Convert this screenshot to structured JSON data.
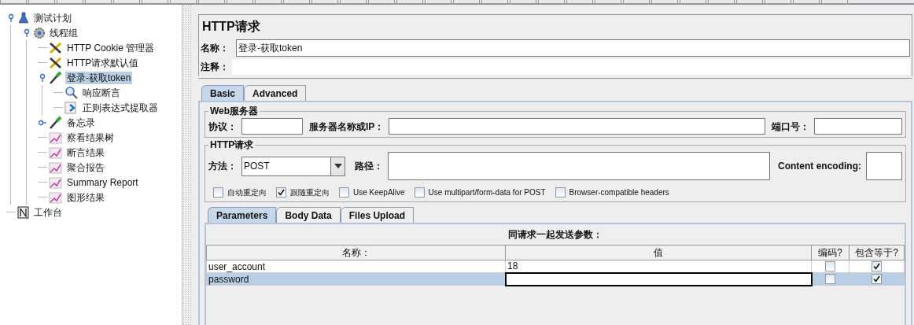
{
  "tree": [
    {
      "label": "测试计划",
      "kind": "plan",
      "expanded": true,
      "selected": false,
      "children": [
        {
          "label": "线程组",
          "kind": "threads",
          "expanded": true,
          "selected": false,
          "children": [
            {
              "label": "HTTP Cookie 管理器",
              "kind": "config",
              "selected": false
            },
            {
              "label": "HTTP请求默认值",
              "kind": "config",
              "selected": false
            },
            {
              "label": "登录-获取token",
              "kind": "sampler",
              "expanded": true,
              "selected": true,
              "children": [
                {
                  "label": "响应断言",
                  "kind": "assertion",
                  "selected": false
                },
                {
                  "label": "正则表达式提取器",
                  "kind": "extractor",
                  "selected": false
                }
              ]
            },
            {
              "label": "备忘录",
              "kind": "sampler",
              "expanded": false,
              "selected": false
            },
            {
              "label": "察看结果树",
              "kind": "listener",
              "selected": false
            },
            {
              "label": "断言结果",
              "kind": "listener",
              "selected": false
            },
            {
              "label": "聚合报告",
              "kind": "listener",
              "selected": false
            },
            {
              "label": "Summary Report",
              "kind": "listener",
              "selected": false
            },
            {
              "label": "图形结果",
              "kind": "listener",
              "selected": false
            }
          ]
        }
      ]
    },
    {
      "label": "工作台",
      "kind": "workbench",
      "selected": false
    }
  ],
  "editor": {
    "title": "HTTP请求",
    "name_label": "名称：",
    "name_value": "登录-获取token",
    "comment_label": "注释：",
    "tabs": [
      {
        "label": "Basic",
        "selected": true
      },
      {
        "label": "Advanced",
        "selected": false
      }
    ],
    "web_server": {
      "title": "Web服务器",
      "protocol_label": "协议：",
      "server_label": "服务器名称或IP：",
      "port_label": "端口号："
    },
    "http_request": {
      "title": "HTTP请求",
      "method_label": "方法：",
      "method": "POST",
      "path_label": "路径：",
      "encoding_label": "Content encoding:",
      "options": [
        {
          "label": "自动重定向",
          "checked": false
        },
        {
          "label": "跟随重定向",
          "checked": true
        },
        {
          "label": "Use KeepAlive",
          "checked": false
        },
        {
          "label": "Use multipart/form-data for POST",
          "checked": false
        },
        {
          "label": "Browser-compatible headers",
          "checked": false
        }
      ]
    },
    "param_tabs": [
      {
        "label": "Parameters",
        "selected": true
      },
      {
        "label": "Body Data",
        "selected": false
      },
      {
        "label": "Files Upload",
        "selected": false
      }
    ],
    "params_title": "同请求一起发送参数：",
    "columns": [
      "名称：",
      "值",
      "编码?",
      "包含等于?"
    ],
    "rows": [
      {
        "name": "user_account",
        "value": "18",
        "encode": false,
        "include_equals": true,
        "selected": false
      },
      {
        "name": "password",
        "encode": false,
        "include_equals": true,
        "selected": true
      }
    ]
  }
}
